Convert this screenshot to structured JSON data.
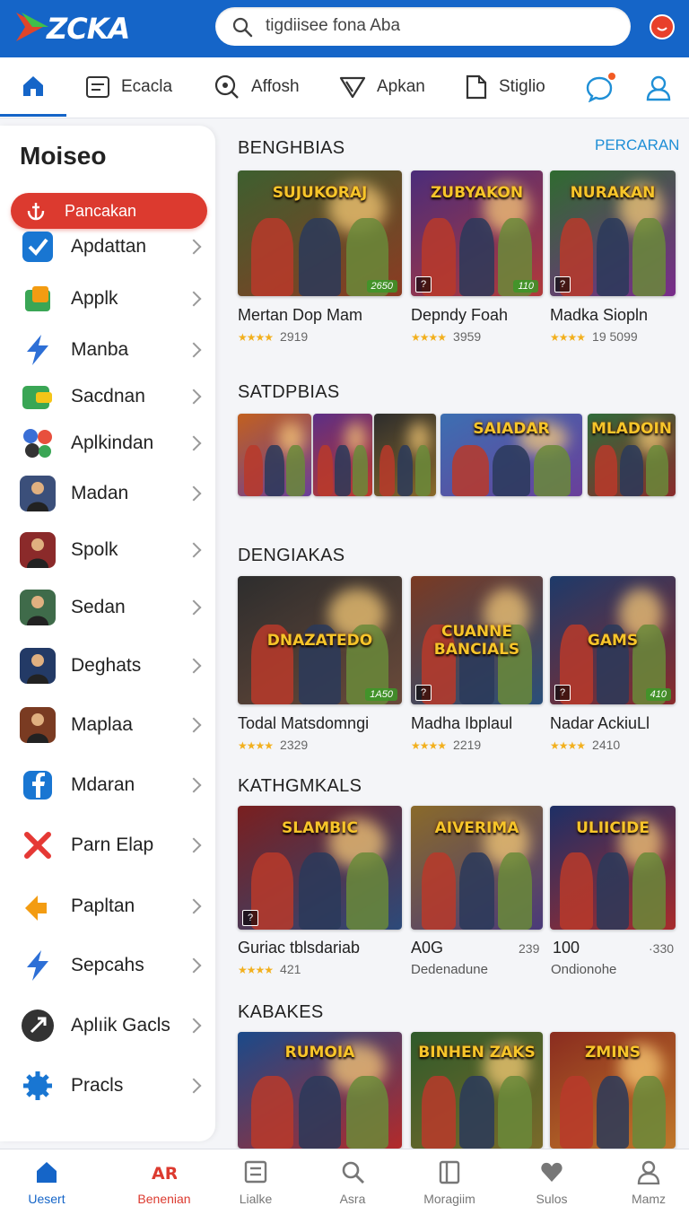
{
  "app": {
    "logo_text": "ZCKA"
  },
  "search": {
    "value": "tigdiisee fona Aba"
  },
  "categories": [
    {
      "label": "Ecacla",
      "icon": "news-icon"
    },
    {
      "label": "Affosh",
      "icon": "search-zoom-icon"
    },
    {
      "label": "Apkan",
      "icon": "send-icon"
    },
    {
      "label": "Stiglio",
      "icon": "document-icon"
    }
  ],
  "sidebar": {
    "title": "Moiseo",
    "cta_label": "Pancakan",
    "items": [
      {
        "label": "Apdattan",
        "icon": "checkbox-icon",
        "color": "#1976d2"
      },
      {
        "label": "Applk",
        "icon": "package-icon",
        "color": "#3aa655"
      },
      {
        "label": "Manba",
        "icon": "bolt-icon",
        "color": "#2d6fd6"
      },
      {
        "label": "Sacdnan",
        "icon": "wallet-icon",
        "color": "#3aa655"
      },
      {
        "label": "Aplkindan",
        "icon": "bubbles-icon",
        "color": "#e84f3d"
      },
      {
        "label": "Madan",
        "icon": "game-thumb-icon",
        "color": "#3b4f7a"
      },
      {
        "label": "Spolk",
        "icon": "game-thumb-icon",
        "color": "#8b2a2a"
      },
      {
        "label": "Sedan",
        "icon": "game-thumb-icon",
        "color": "#3f6b4a"
      },
      {
        "label": "Deghats",
        "icon": "game-thumb-icon",
        "color": "#233a66"
      },
      {
        "label": "Maplaa",
        "icon": "game-thumb-icon",
        "color": "#7a3b22"
      },
      {
        "label": "Mdaran",
        "icon": "facebook-icon",
        "color": "#1976d2"
      },
      {
        "label": "Parn Elap",
        "icon": "cross-icon",
        "color": "#e53935"
      },
      {
        "label": "Papltan",
        "icon": "arrows-icon",
        "color": "#f39c12"
      },
      {
        "label": "Sepcahs",
        "icon": "bolt-icon",
        "color": "#2d6fd6"
      },
      {
        "label": "Aplıik Gacls",
        "icon": "rocket-icon",
        "color": "#333333"
      },
      {
        "label": "Pracls",
        "icon": "gear-icon",
        "color": "#1976d2"
      }
    ]
  },
  "sections": {
    "s1": {
      "title": "BENGHBIAS",
      "see_all": "PERCARAN",
      "cards": [
        {
          "title": "Mertan Dop Mam",
          "rating": "2919",
          "cap": "SUJUKORAJ",
          "tag": "2650",
          "bg": [
            "#3d5f2f",
            "#8c3b22"
          ]
        },
        {
          "title": "Depndy Foah",
          "rating": "3959",
          "cap": "ZUBYAKON",
          "tag": "110",
          "bg": [
            "#4a2c7a",
            "#b23a3a"
          ]
        },
        {
          "title": "Madka Siopln",
          "rating": "19 5099",
          "cap": "NURAKAN",
          "tag": "",
          "bg": [
            "#2f6b2f",
            "#7a2c8c"
          ]
        }
      ]
    },
    "s2": {
      "title": "SATDPBIAS",
      "cards": [
        {
          "cap": "",
          "bg": [
            "#c2601f",
            "#6a3f9a"
          ]
        },
        {
          "cap": "",
          "bg": [
            "#5b2e86",
            "#c0392b"
          ]
        },
        {
          "cap": "",
          "bg": [
            "#2c2c2c",
            "#8a6a2a"
          ]
        },
        {
          "cap": "SAIADAR",
          "bg": [
            "#3c6fb2",
            "#6a3f9a"
          ]
        },
        {
          "cap": "MLADOIN",
          "bg": [
            "#2f6b3a",
            "#8a2c2c"
          ]
        }
      ]
    },
    "s3": {
      "title": "DENGIAKAS",
      "cards": [
        {
          "title": "Todal Matsdomngi",
          "rating": "2329",
          "cap": "DNAZATEDO",
          "tag": "1A50",
          "bg": [
            "#2d2d2d",
            "#6a4a3a"
          ]
        },
        {
          "title": "Madha Ibplaul",
          "rating": "2219",
          "cap": "CUANNE BANCIALS",
          "tag": "",
          "bg": [
            "#7a3a22",
            "#2a4f7a"
          ]
        },
        {
          "title": "Nadar AckiuLl",
          "rating": "2410",
          "cap": "GAMS",
          "tag": "410",
          "bg": [
            "#1d3a6a",
            "#8a2c2c"
          ]
        }
      ]
    },
    "s4": {
      "title": "KATHGMKALS",
      "cards": [
        {
          "title": "Guriac tblsdariab",
          "rating": "421",
          "num": "",
          "cap": "SLAMBIC",
          "bg": [
            "#7a1f1f",
            "#2c4a7a"
          ]
        },
        {
          "title": "A0G",
          "meta": "Dedenadune",
          "num": "239",
          "cap": "AIVERIMA",
          "bg": [
            "#8a6a2a",
            "#4a3a7a"
          ]
        },
        {
          "title": "100",
          "meta": "Ondionohe",
          "num": "·330",
          "cap": "ULIICIDE",
          "bg": [
            "#1d2f66",
            "#a82c2c"
          ]
        }
      ]
    },
    "s5": {
      "title": "KABAKES",
      "cards": [
        {
          "cap": "RUMOIA",
          "bg": [
            "#1a4a8a",
            "#b32a2a"
          ]
        },
        {
          "cap": "BINHEN ZAKS",
          "bg": [
            "#2f5a2a",
            "#7a6a2a"
          ]
        },
        {
          "cap": "ZMINS",
          "bg": [
            "#8a2c1f",
            "#c0782a"
          ]
        }
      ]
    }
  },
  "bottom_nav": [
    {
      "label": "Uesert",
      "icon": "home-icon",
      "active": true
    },
    {
      "label": "Benenian",
      "icon": "ar-icon",
      "active": false
    },
    {
      "label": "Lialke",
      "icon": "list-icon",
      "active": false
    },
    {
      "label": "Asra",
      "icon": "search-icon",
      "active": false
    },
    {
      "label": "Moragiim",
      "icon": "book-icon",
      "active": false
    },
    {
      "label": "Sulos",
      "icon": "heart-icon",
      "active": false
    },
    {
      "label": "Mamz",
      "icon": "user-icon",
      "active": false
    }
  ],
  "colors": {
    "brand": "#1565c8",
    "accent": "#dc3a2f",
    "link": "#1f8fd6",
    "star": "#f2b01e"
  }
}
